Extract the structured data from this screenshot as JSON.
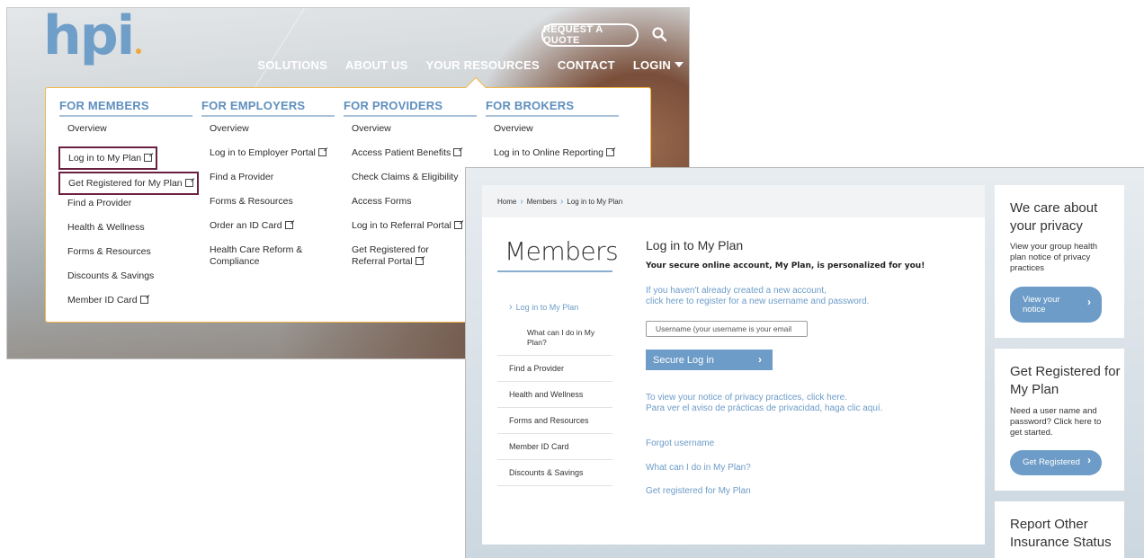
{
  "nav_screenshot": {
    "logo": "hpi",
    "request_quote": "REQUEST A QUOTE",
    "main_nav": [
      "SOLUTIONS",
      "ABOUT US",
      "YOUR RESOURCES",
      "CONTACT",
      "LOGIN"
    ],
    "mega_menu": {
      "members": {
        "heading": "FOR MEMBERS",
        "items": [
          "Overview",
          "Log in to My Plan",
          "Get Registered for My Plan",
          "Find a Provider",
          "Health & Wellness",
          "Forms & Resources",
          "Discounts & Savings",
          "Member ID Card"
        ]
      },
      "employers": {
        "heading": "FOR EMPLOYERS",
        "items": [
          "Overview",
          "Log in to Employer Portal",
          "Find a Provider",
          "Forms & Resources",
          "Order an ID Card",
          "Health Care Reform & Compliance"
        ]
      },
      "providers": {
        "heading": "FOR PROVIDERS",
        "items": [
          "Overview",
          "Access Patient Benefits",
          "Check Claims & Eligibility",
          "Access Forms",
          "Log in to Referral Portal",
          "Get Registered for Referral Portal"
        ]
      },
      "brokers": {
        "heading": "FOR BROKERS",
        "items": [
          "Overview",
          "Log in to Online Reporting"
        ]
      }
    }
  },
  "login_screenshot": {
    "breadcrumb": [
      "Home",
      "Members",
      "Log in to My Plan"
    ],
    "section_title": "Members",
    "sidebar": {
      "active": "Log in to My Plan",
      "sub": "What can I do in My Plan?",
      "items": [
        "Find a Provider",
        "Health and Wellness",
        "Forms and Resources",
        "Member ID Card",
        "Discounts & Savings"
      ]
    },
    "main": {
      "title": "Log in to My Plan",
      "subtitle": "Your secure online account, My Plan, is personalized for you!",
      "register_line1": "If you haven't already created a new account,",
      "register_line2": "click here to register for a new username and password.",
      "username_placeholder": "Username (your username is your email",
      "login_button": "Secure Log in",
      "privacy_line1": "To view your notice of privacy practices, click here.",
      "privacy_line2": "Para ver el aviso de prácticas de privacidad, haga clic aquí.",
      "forgot": "Forgot username",
      "what_can": "What can I do in My Plan?",
      "get_registered": "Get registered for My Plan"
    },
    "cards": {
      "privacy": {
        "title": "We care about your privacy",
        "body": "View your group health plan notice of privacy practices",
        "button": "View your notice"
      },
      "register": {
        "title": "Get Registered for My Plan",
        "body": "Need a user name and password? Click here to get started.",
        "button": "Get Registered"
      },
      "report": {
        "title": "Report Other Insurance Status"
      }
    },
    "colors": {
      "accent": "#6d9cc8",
      "highlight_box": "#6a2040",
      "menu_border": "#f2b746"
    }
  }
}
